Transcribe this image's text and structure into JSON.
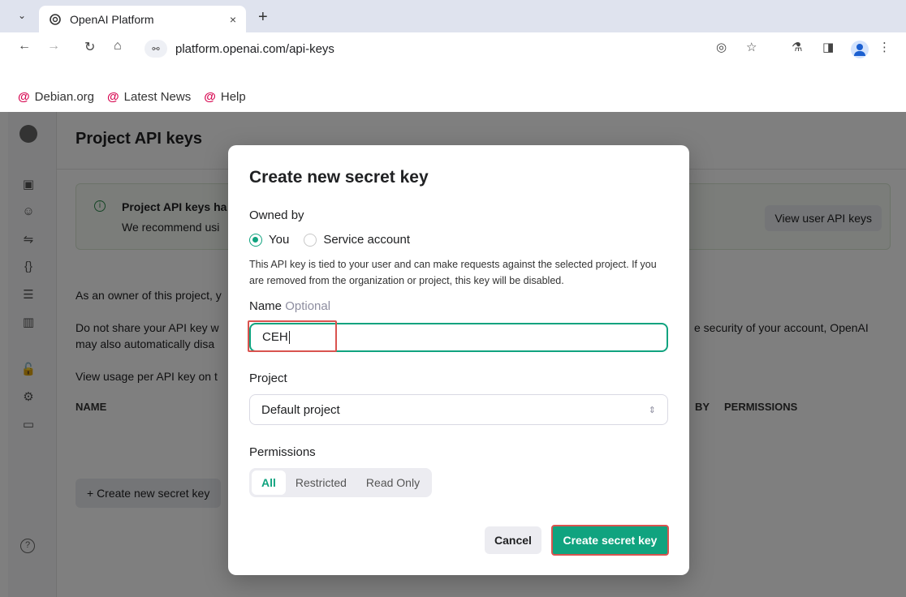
{
  "browser": {
    "tab_title": "OpenAI Platform",
    "tab_close": "×",
    "new_tab": "+",
    "url": "platform.openai.com/api-keys",
    "bookmarks": [
      "Debian.org",
      "Latest News",
      "Help"
    ]
  },
  "page": {
    "title": "Project API keys",
    "info_title": "Project API keys ha",
    "info_text": "We recommend usi",
    "view_user_keys": "View user API keys",
    "para1": "As an owner of this project, y",
    "para2a": "Do not share your API key w",
    "para2b": "may also automatically disa",
    "para2_right": "e security of your account, OpenAI",
    "para3": "View usage per API key on t",
    "col_name": "NAME",
    "col_by": "BY",
    "col_permissions": "PERMISSIONS",
    "create_key_button": "+ Create new secret key"
  },
  "modal": {
    "title": "Create new secret key",
    "owned_by_label": "Owned by",
    "owner_you": "You",
    "owner_service": "Service account",
    "owner_selected": "You",
    "description": "This API key is tied to your user and can make requests against the selected project. If you are removed from the organization or project, this key will be disabled.",
    "name_label": "Name",
    "name_optional": "Optional",
    "name_value": "CEH",
    "project_label": "Project",
    "project_value": "Default project",
    "permissions_label": "Permissions",
    "permissions_options": [
      "All",
      "Restricted",
      "Read Only"
    ],
    "permissions_selected": "All",
    "cancel": "Cancel",
    "create": "Create secret key"
  },
  "colors": {
    "accent": "#10a37f",
    "highlight": "#d9534f"
  }
}
